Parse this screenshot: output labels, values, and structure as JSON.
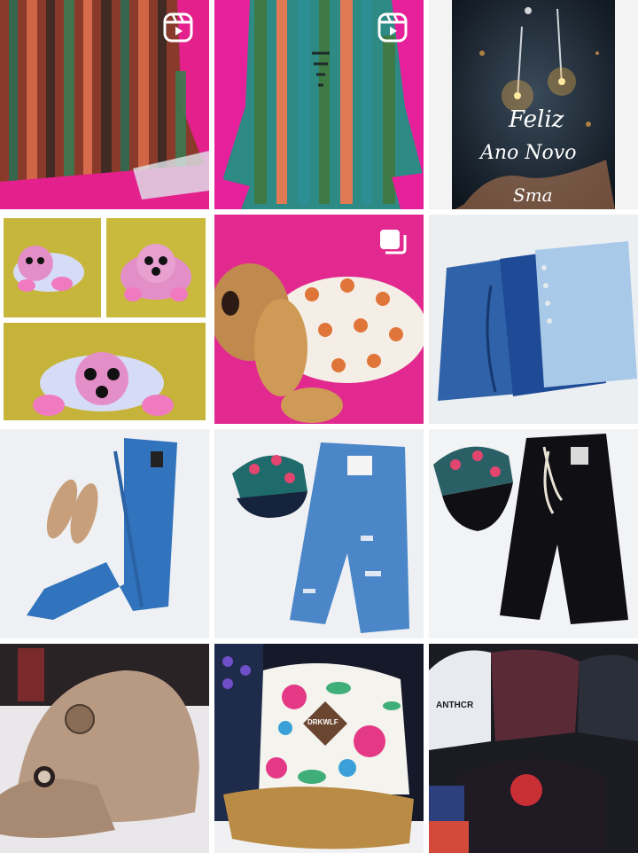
{
  "grid": {
    "posts": [
      {
        "type": "reel",
        "subject": "striped romper, side view"
      },
      {
        "type": "reel",
        "subject": "striped romper, front view"
      },
      {
        "type": "photo",
        "subject": "sparklers new year card"
      },
      {
        "type": "photo",
        "subject": "plush dog collage"
      },
      {
        "type": "carousel",
        "subject": "fox print plush dog"
      },
      {
        "type": "photo",
        "subject": "denim shorts pair"
      },
      {
        "type": "photo",
        "subject": "jeans with flats"
      },
      {
        "type": "photo",
        "subject": "cap with denim bermuda"
      },
      {
        "type": "photo",
        "subject": "cap with black bermuda"
      },
      {
        "type": "photo",
        "subject": "suede baseball cap"
      },
      {
        "type": "photo",
        "subject": "floral snapback"
      },
      {
        "type": "photo",
        "subject": "caps display"
      }
    ]
  },
  "overlays": {
    "newyear_line1": "Feliz",
    "newyear_line2": "Ano Novo",
    "newyear_line3": "Sma",
    "cap_patch": "DRKWLF",
    "cap_brand": "ANTHCR"
  },
  "colors": {
    "grid_bg": "#ffffff",
    "pink_backdrop": "#e8208f",
    "yellow_backdrop": "#c8b83a",
    "denim": "#2f6fb5",
    "sheet": "#f1f2f4"
  },
  "icons": [
    "reel-icon",
    "carousel-icon"
  ]
}
